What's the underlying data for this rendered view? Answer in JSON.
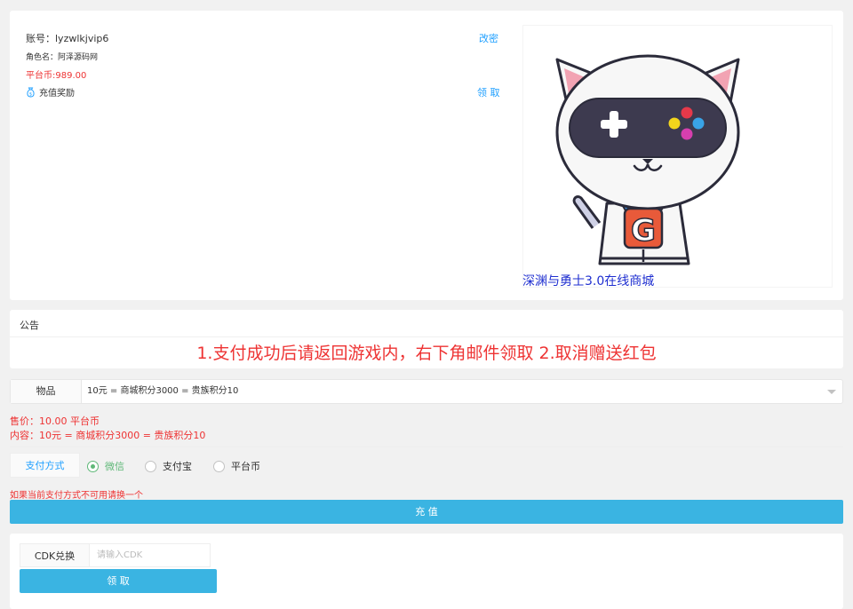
{
  "account": {
    "label": "账号：",
    "value": "lyzwlkjvip6",
    "change_password": "改密",
    "role_label": "角色名：",
    "role_value": "阿泽源码网",
    "coin_label": "平台币:",
    "coin_value": "989.00",
    "bonus_icon": "money-bag-icon",
    "bonus_label": "充值奖励",
    "claim_link": "领 取"
  },
  "banner": {
    "logo_letter": "G",
    "shop_title": "深渊与勇士3.0在线商城"
  },
  "notice": {
    "label": "公告",
    "text": "1.支付成功后请返回游戏内，右下角邮件领取 2.取消赠送红包"
  },
  "item": {
    "label": "物品",
    "selected": "10元 = 商城积分3000 = 贵族积分10"
  },
  "price": {
    "sale_label": "售价：",
    "sale_value": "10.00 平台币",
    "content_label": "内容：",
    "content_value": "10元 = 商城积分3000 = 贵族积分10"
  },
  "payment": {
    "label": "支付方式",
    "options": [
      "微信",
      "支付宝",
      "平台币"
    ],
    "selected": "微信",
    "hint": "如果当前支付方式不可用请换一个",
    "submit": "充 值"
  },
  "cdk": {
    "label": "CDK兑换",
    "placeholder": "请输入CDK",
    "value": "",
    "submit": "领 取"
  },
  "colors": {
    "accent": "#3ab4e2",
    "link": "#1e9fff",
    "alert": "#ee3333",
    "radio_checked": "#5fb878",
    "title_blue": "#1f2fd0"
  }
}
